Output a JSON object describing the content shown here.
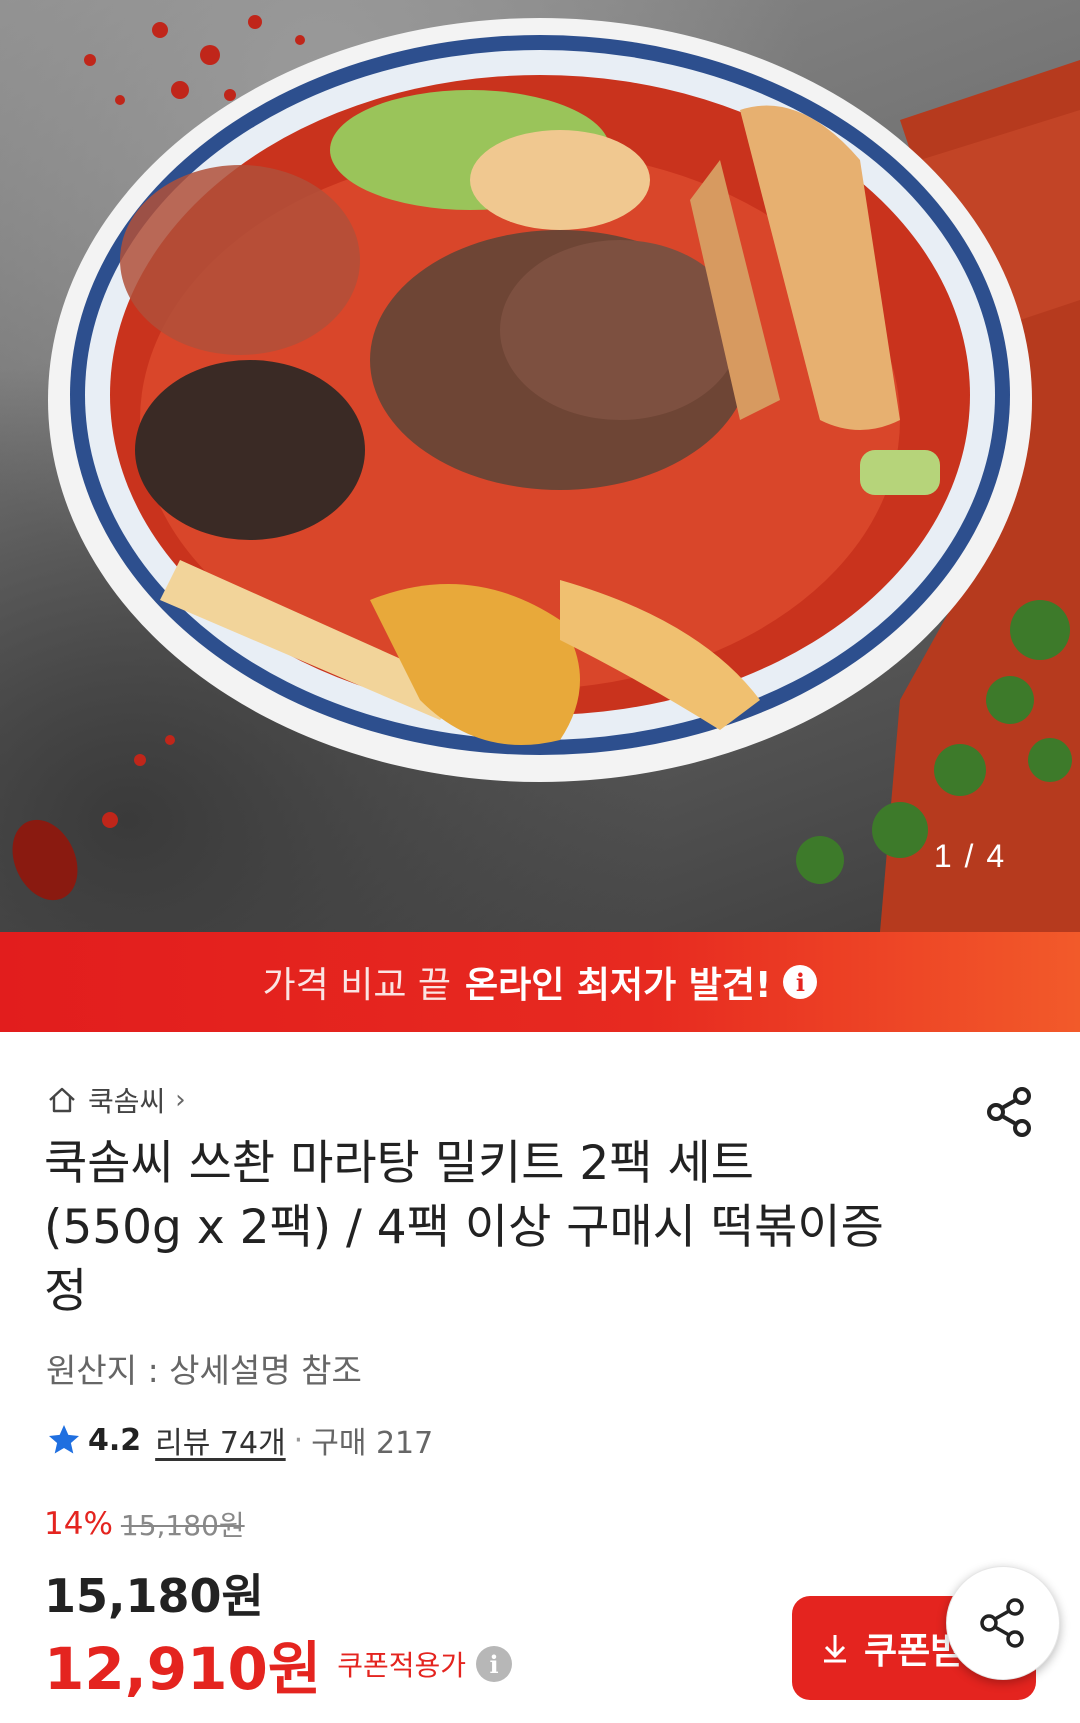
{
  "hero": {
    "page_indicator": "1 / 4",
    "image_subject": "mala-tang-bowl"
  },
  "promo_banner": {
    "text_light": "가격 비교 끝",
    "text_bold": "온라인 최저가 발견!",
    "icon": "info-icon"
  },
  "product": {
    "store_name": "쿡솜씨",
    "title": "쿡솜씨 쓰촨 마라탕 밀키트 2팩 세트 (550g x 2팩) / 4팩 이상 구매시 떡볶이증정",
    "origin": "원산지 : 상세설명 참조",
    "rating": "4.2",
    "reviews": "리뷰 74개",
    "purchases": "구매 217"
  },
  "price": {
    "discount_rate": "14%",
    "original_price": "15,180원",
    "sale_price": "15,180원",
    "coupon_price": "12,910원",
    "coupon_label": "쿠폰적용가"
  },
  "coupon_button": {
    "label": "쿠폰받기"
  },
  "colors": {
    "accent": "#e4241f",
    "star": "#1f6fe0"
  }
}
